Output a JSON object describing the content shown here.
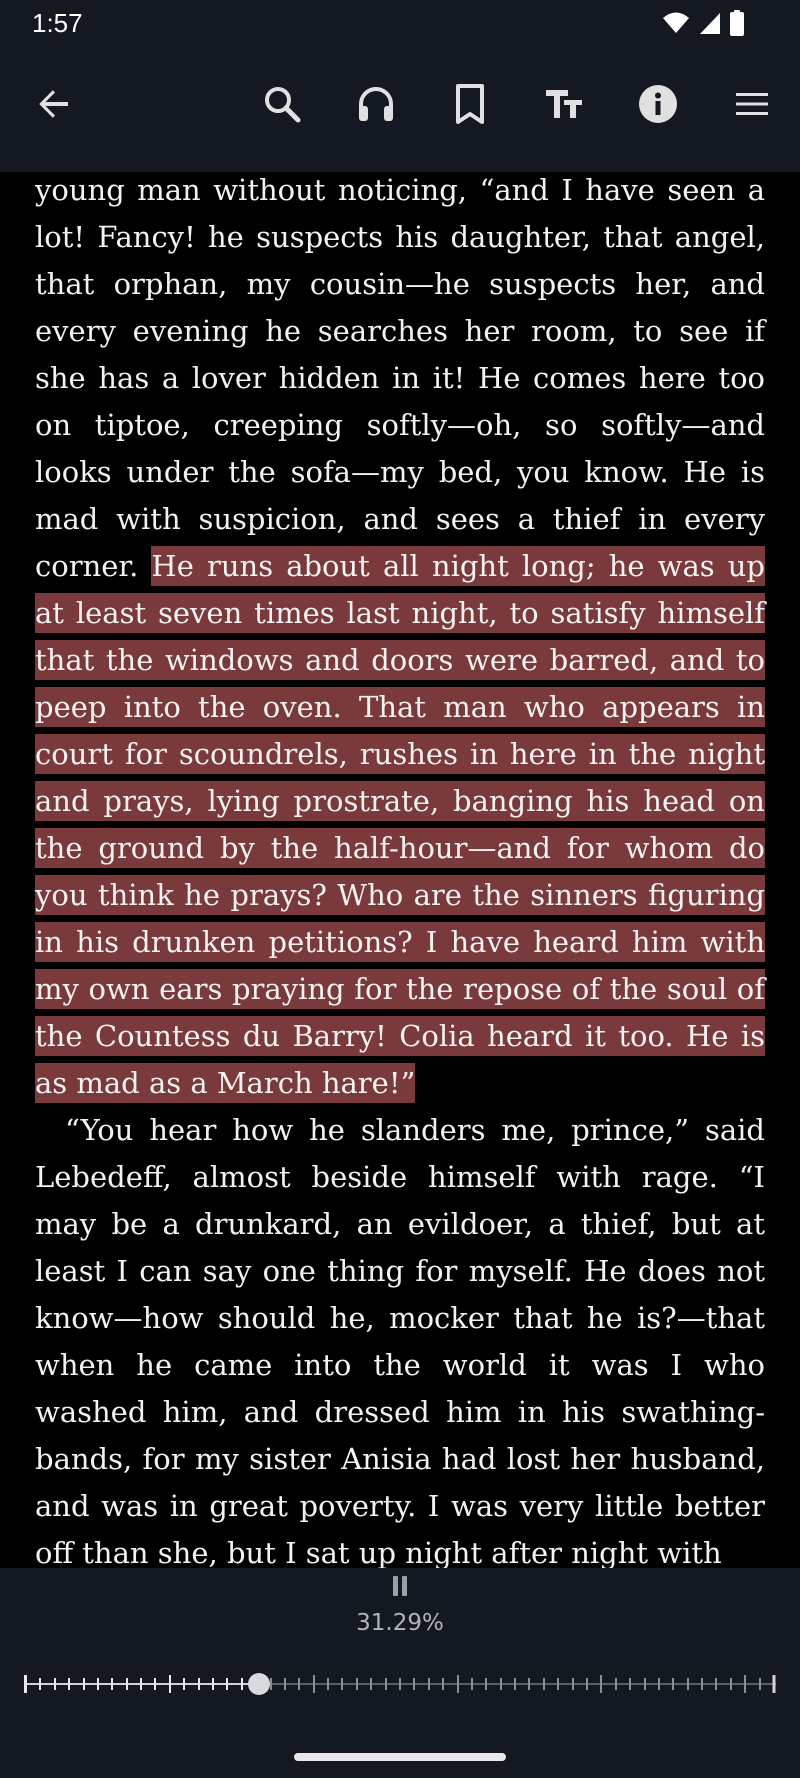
{
  "status_bar": {
    "time": "1:57",
    "icons": [
      "wifi-icon",
      "cellular-signal-icon",
      "battery-icon"
    ]
  },
  "toolbar": {
    "buttons": [
      "back-arrow-icon",
      "search-icon",
      "headphones-icon",
      "bookmark-icon",
      "text-size-icon",
      "info-icon",
      "menu-icon"
    ]
  },
  "reader": {
    "para1_before": "young man without noticing, “and I have seen a lot! Fancy! he suspects his daughter, that angel, that orphan, my cousin—he suspects her, and every evening he searches her room, to see if she has a lover hidden in it! He comes here too on tiptoe, creeping softly—oh, so softly—and looks under the sofa—my bed, you know. He is mad with suspicion, and sees a thief in every corner. ",
    "para1_highlight": "He runs about all night long; he was up at least seven times last night, to satisfy himself that the windows and doors were barred, and to peep into the oven. That man who appears in court for scoundrels, rushes in here in the night and prays, lying prostrate, banging his head on the ground by the half-hour—and for whom do you think he prays? Who are the sinners figuring in his drunken petitions? I have heard him with my own ears praying for the repose of the soul of the Countess du Barry! Colia heard it too. He is as mad as a March hare!”",
    "para2": "“You hear how he slanders me, prince,” said Lebedeff, almost beside himself with rage. “I may be a drunkard, an evildoer, a thief, but at least I can say one thing for myself. He does not know—how should he, mocker that he is?—that when he came into the world it was I who washed him, and dressed him in his swathing-bands, for my sister Anisia had lost her husband, and was in great poverty. I was very little better off than she, but I sat up night after night with",
    "highlight_color": "#7a3a3c"
  },
  "playback": {
    "state_icon": "pause-icon",
    "progress_label": "31.29%",
    "progress_fraction": 0.3129
  },
  "colors": {
    "bar_background": "#141821",
    "page_background": "#000000",
    "text": "#f2f2f2"
  }
}
